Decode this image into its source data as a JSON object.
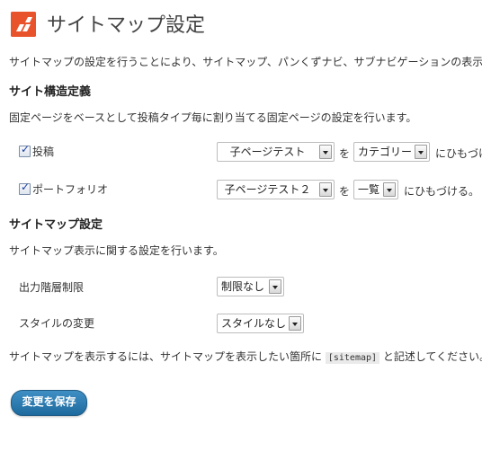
{
  "page": {
    "title": "サイトマップ設定",
    "description": "サイトマップの設定を行うことにより、サイトマップ、パンくずナビ、サブナビゲーションの表示"
  },
  "structure": {
    "heading": "サイト構造定義",
    "description": "固定ページをベースとして投稿タイプ毎に割り当てる固定ページの設定を行います。",
    "rows": [
      {
        "label": "投稿",
        "checked": true,
        "page_select": "子ページテスト",
        "wo": "を",
        "type_select": "カテゴリー",
        "suffix": "にひもづけ"
      },
      {
        "label": "ポートフォリオ",
        "checked": true,
        "page_select": "子ページテスト２",
        "wo": "を",
        "type_select": "一覧",
        "suffix": "にひもづける。"
      }
    ]
  },
  "sitemap": {
    "heading": "サイトマップ設定",
    "description": "サイトマップ表示に関する設定を行います。",
    "depth_label": "出力階層制限",
    "depth_value": "制限なし",
    "style_label": "スタイルの変更",
    "style_value": "スタイルなし",
    "note_before": "サイトマップを表示するには、サイトマップを表示したい箇所に",
    "shortcode": "[sitemap]",
    "note_after": "と記述してください。"
  },
  "save_button": "変更を保存",
  "colors": {
    "logo": "#e8532b",
    "button": "#2a79ad",
    "check": "#1a3fa0"
  }
}
